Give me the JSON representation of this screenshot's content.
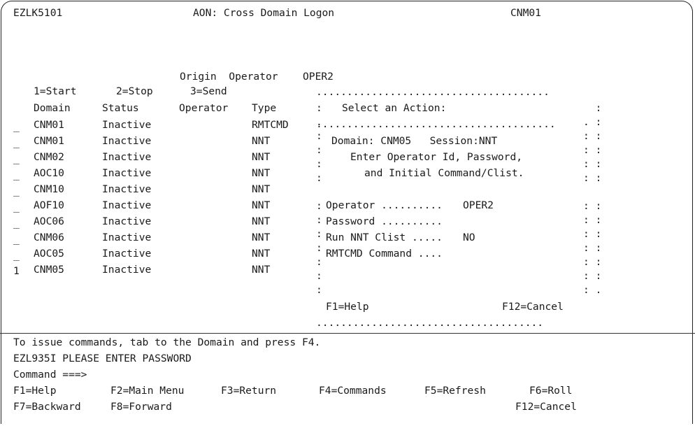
{
  "screen": {
    "id": "EZLK5101",
    "title": "AON: Cross Domain Logon",
    "domain": "CNM01"
  },
  "origin_operator": {
    "label": "Origin  Operator",
    "value": "OPER2"
  },
  "actions": {
    "start": "1=Start",
    "stop": "2=Stop",
    "send": "3=Send"
  },
  "table": {
    "headers": {
      "domain": "Domain",
      "status": "Status",
      "operator": "Operator",
      "type": "Type"
    },
    "rows": [
      {
        "selector": "_",
        "domain": "CNM01",
        "status": "Inactive",
        "operator": "",
        "type": "RMTCMD"
      },
      {
        "selector": "_",
        "domain": "CNM01",
        "status": "Inactive",
        "operator": "",
        "type": "NNT"
      },
      {
        "selector": "_",
        "domain": "CNM02",
        "status": "Inactive",
        "operator": "",
        "type": "NNT"
      },
      {
        "selector": "_",
        "domain": "AOC10",
        "status": "Inactive",
        "operator": "",
        "type": "NNT"
      },
      {
        "selector": "_",
        "domain": "CNM10",
        "status": "Inactive",
        "operator": "",
        "type": "NNT"
      },
      {
        "selector": "_",
        "domain": "AOF10",
        "status": "Inactive",
        "operator": "",
        "type": "NNT"
      },
      {
        "selector": "_",
        "domain": "AOC06",
        "status": "Inactive",
        "operator": "",
        "type": "NNT"
      },
      {
        "selector": "_",
        "domain": "CNM06",
        "status": "Inactive",
        "operator": "",
        "type": "NNT"
      },
      {
        "selector": "_",
        "domain": "AOC05",
        "status": "Inactive",
        "operator": "",
        "type": "NNT"
      },
      {
        "selector": "1",
        "domain": "CNM05",
        "status": "Inactive",
        "operator": "",
        "type": "NNT"
      }
    ]
  },
  "popup": {
    "border_top": "......................................",
    "title": "Select an Action:",
    "domain_line": "Domain: CNM05   Session:NNT",
    "instruction1": "Enter Operator Id, Password,",
    "instruction2": "and Initial Command/Clist.",
    "operator_label": "Operator ..........",
    "operator_value": "OPER2",
    "password_label": "Password ..........",
    "clist_label": "Run NNT Clist .....",
    "clist_value": "NO",
    "rmtcmd_label": "RMTCMD Command ....",
    "help": "F1=Help",
    "cancel": "F12=Cancel",
    "border_bottom": "....................................."
  },
  "message": "To issue commands, tab to the Domain and press F4.",
  "status_msg": "EZL935I PLEASE ENTER PASSWORD",
  "command_prompt": "Command ===>",
  "fkeys": {
    "f1": "F1=Help",
    "f2": "F2=Main Menu",
    "f3": "F3=Return",
    "f4": "F4=Commands",
    "f5": "F5=Refresh",
    "f6": "F6=Roll",
    "f7": "F7=Backward",
    "f8": "F8=Forward",
    "f12": "F12=Cancel"
  }
}
